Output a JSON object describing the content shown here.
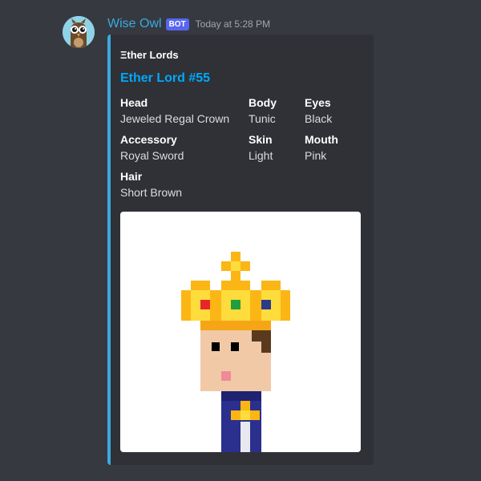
{
  "message": {
    "author": "Wise Owl",
    "bot_tag": "BOT",
    "timestamp": "Today at 5:28 PM",
    "avatar_icon": "owl-avatar-icon"
  },
  "embed": {
    "accent_color": "#3ba9e0",
    "author": "Ξther Lords",
    "title": "Ether Lord #55",
    "fields": [
      {
        "name": "Head",
        "value": "Jeweled Regal Crown"
      },
      {
        "name": "Body",
        "value": "Tunic"
      },
      {
        "name": "Eyes",
        "value": "Black"
      },
      {
        "name": "Accessory",
        "value": "Royal Sword"
      },
      {
        "name": "Skin",
        "value": "Light"
      },
      {
        "name": "Mouth",
        "value": "Pink"
      },
      {
        "name": "Hair",
        "value": "Short Brown"
      }
    ],
    "image_icon": "pixel-art-lord-image"
  }
}
